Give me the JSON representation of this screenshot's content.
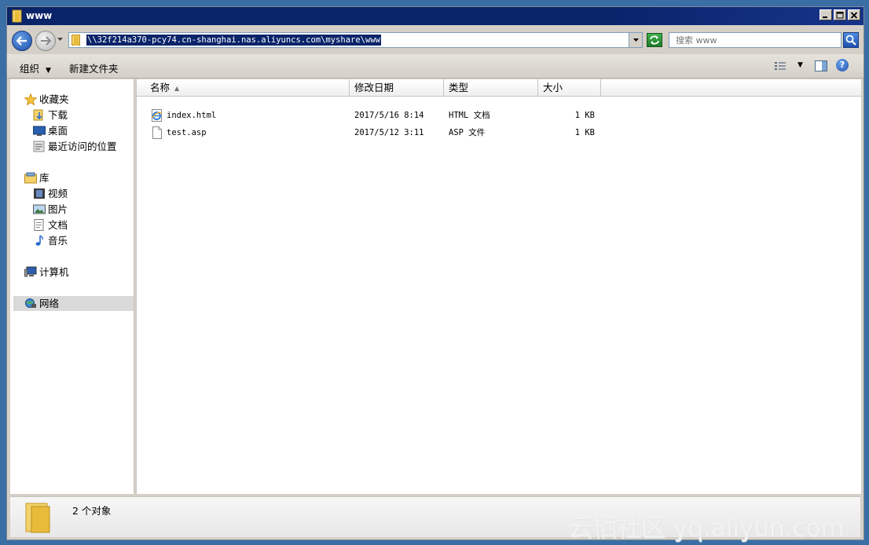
{
  "window": {
    "title": "www",
    "buttons": {
      "minimize": "minimize",
      "maximize": "maximize",
      "close": "close"
    }
  },
  "address": {
    "path": "\\\\32f214a370-pcy74.cn-shanghai.nas.aliyuncs.com\\myshare\\www"
  },
  "search": {
    "placeholder": "搜索 www"
  },
  "toolbar": {
    "organize_label": "组织",
    "new_folder_label": "新建文件夹"
  },
  "sidebar": {
    "favorites": {
      "label": "收藏夹",
      "items": [
        {
          "label": "下载"
        },
        {
          "label": "桌面"
        },
        {
          "label": "最近访问的位置"
        }
      ]
    },
    "libraries": {
      "label": "库",
      "items": [
        {
          "label": "视频"
        },
        {
          "label": "图片"
        },
        {
          "label": "文档"
        },
        {
          "label": "音乐"
        }
      ]
    },
    "computer": {
      "label": "计算机"
    },
    "network": {
      "label": "网络"
    }
  },
  "file_list": {
    "columns": [
      {
        "label": "名称"
      },
      {
        "label": "修改日期"
      },
      {
        "label": "类型"
      },
      {
        "label": "大小"
      }
    ],
    "rows": [
      {
        "name": "index.html",
        "modified": "2017/5/16 8:14",
        "type": "HTML 文档",
        "size": "1 KB",
        "icon": "ie-html-icon"
      },
      {
        "name": "test.asp",
        "modified": "2017/5/12 3:11",
        "type": "ASP 文件",
        "size": "1 KB",
        "icon": "blank-file-icon"
      }
    ]
  },
  "status": {
    "item_count": "2 个对象"
  },
  "watermark": "云栖社区 yq.aliyun.com",
  "colors": {
    "titlebar": "#0a246a",
    "desktop": "#3a6ea5",
    "selection": "#0a246a"
  }
}
